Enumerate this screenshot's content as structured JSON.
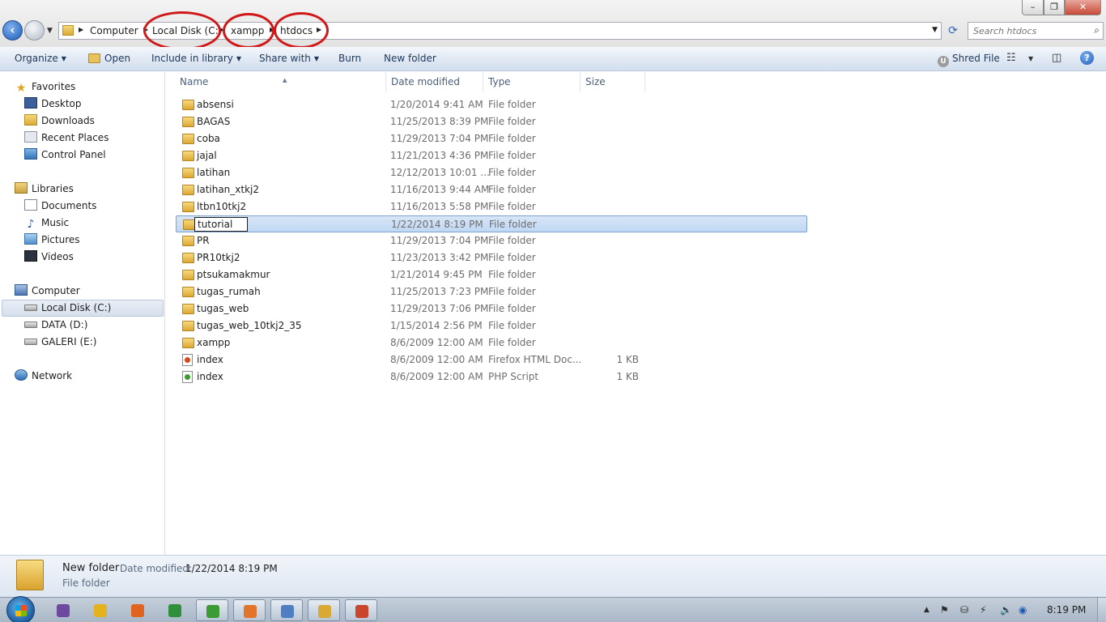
{
  "window": {
    "min_label": "–",
    "max_label": "❐",
    "close_label": "✕"
  },
  "address_bar": {
    "crumbs": [
      "Computer",
      "Local Disk (C:)",
      "xampp",
      "htdocs"
    ]
  },
  "search": {
    "placeholder": "Search htdocs"
  },
  "toolbar": {
    "organize": "Organize",
    "open": "Open",
    "include_in_library": "Include in library",
    "share_with": "Share with",
    "burn": "Burn",
    "new_folder": "New folder",
    "shred_file": "Shred File"
  },
  "nav": {
    "favorites": {
      "label": "Favorites",
      "items": [
        "Desktop",
        "Downloads",
        "Recent Places",
        "Control Panel"
      ]
    },
    "libraries": {
      "label": "Libraries",
      "items": [
        "Documents",
        "Music",
        "Pictures",
        "Videos"
      ]
    },
    "computer": {
      "label": "Computer",
      "items": [
        "Local Disk (C:)",
        "DATA (D:)",
        "GALERI (E:)"
      ]
    },
    "network": {
      "label": "Network"
    }
  },
  "columns": {
    "name": "Name",
    "date": "Date modified",
    "type": "Type",
    "size": "Size"
  },
  "files": [
    {
      "name": "absensi",
      "date": "1/20/2014 9:41 AM",
      "type": "File folder",
      "size": "",
      "icon": "folder-icon"
    },
    {
      "name": "BAGAS",
      "date": "11/25/2013 8:39 PM",
      "type": "File folder",
      "size": "",
      "icon": "folder-icon"
    },
    {
      "name": "coba",
      "date": "11/29/2013 7:04 PM",
      "type": "File folder",
      "size": "",
      "icon": "folder-icon"
    },
    {
      "name": "jajal",
      "date": "11/21/2013 4:36 PM",
      "type": "File folder",
      "size": "",
      "icon": "folder-icon"
    },
    {
      "name": "latihan",
      "date": "12/12/2013 10:01 ...",
      "type": "File folder",
      "size": "",
      "icon": "folder-icon"
    },
    {
      "name": "latihan_xtkj2",
      "date": "11/16/2013 9:44 AM",
      "type": "File folder",
      "size": "",
      "icon": "folder-icon"
    },
    {
      "name": "ltbn10tkj2",
      "date": "11/16/2013 5:58 PM",
      "type": "File folder",
      "size": "",
      "icon": "folder-icon"
    },
    {
      "name": "tutorial",
      "date": "1/22/2014 8:19 PM",
      "type": "File folder",
      "size": "",
      "icon": "folder-icon",
      "renaming": true
    },
    {
      "name": "PR",
      "date": "11/29/2013 7:04 PM",
      "type": "File folder",
      "size": "",
      "icon": "folder-icon"
    },
    {
      "name": "PR10tkj2",
      "date": "11/23/2013 3:42 PM",
      "type": "File folder",
      "size": "",
      "icon": "folder-icon"
    },
    {
      "name": "ptsukamakmur",
      "date": "1/21/2014 9:45 PM",
      "type": "File folder",
      "size": "",
      "icon": "folder-icon"
    },
    {
      "name": "tugas_rumah",
      "date": "11/25/2013 7:23 PM",
      "type": "File folder",
      "size": "",
      "icon": "folder-icon"
    },
    {
      "name": "tugas_web",
      "date": "11/29/2013 7:06 PM",
      "type": "File folder",
      "size": "",
      "icon": "folder-icon"
    },
    {
      "name": "tugas_web_10tkj2_35",
      "date": "1/15/2014 2:56 PM",
      "type": "File folder",
      "size": "",
      "icon": "folder-icon"
    },
    {
      "name": "xampp",
      "date": "8/6/2009 12:00 AM",
      "type": "File folder",
      "size": "",
      "icon": "folder-icon"
    },
    {
      "name": "index",
      "date": "8/6/2009 12:00 AM",
      "type": "Firefox HTML Doc...",
      "size": "1 KB",
      "icon": "html-file-icon"
    },
    {
      "name": "index",
      "date": "8/6/2009 12:00 AM",
      "type": "PHP Script",
      "size": "1 KB",
      "icon": "php-file-icon"
    }
  ],
  "details": {
    "name": "New folder",
    "date_label": "Date modified:",
    "date_value": "1/22/2014 8:19 PM",
    "type": "File folder"
  },
  "taskbar": {
    "clock": "8:19 PM",
    "apps": [
      "visual-studio-icon",
      "chrome-icon",
      "firefox-icon",
      "media-player-icon",
      "dreamweaver-icon",
      "xampp-icon",
      "notepad-icon",
      "explorer-icon",
      "powerpoint-icon"
    ]
  },
  "colors": {
    "annotation": "#d01818",
    "selection": "#c0d8f3",
    "toolbar_text": "#1e395b"
  }
}
